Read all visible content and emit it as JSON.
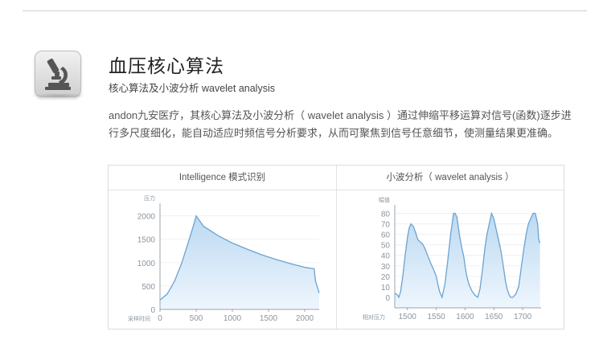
{
  "section": {
    "title": "血压核心算法",
    "subtitle": "核心算法及小波分析 wavelet analysis",
    "description_lines": [
      "andon九安医疗，其核心算法及小波分析（ wavelet analysis ）通过伸缩平移运算对信号(函数)逐步进",
      "行多尺度细化，能自动适应时频信号分析要求，从而可聚焦到信号任意细节，使测量结果更准确。"
    ],
    "icon": "microscope-icon"
  },
  "colors": {
    "line": "#6aa3d1",
    "fill_top": "#bcd9f2",
    "fill_bottom": "#eef6fd",
    "axis": "#9aa4ad",
    "tick_text": "#8a96a0"
  },
  "chart_data": [
    {
      "type": "area",
      "title": "Intelligence 模式识别",
      "ylabel": "压力",
      "xlabel": "采样时间",
      "xlim": [
        0,
        2200
      ],
      "ylim": [
        0,
        2200
      ],
      "x_ticks": [
        0,
        500,
        1000,
        1500,
        2000
      ],
      "y_ticks": [
        0,
        500,
        1000,
        1500,
        2000
      ],
      "grid": true,
      "x": [
        0,
        100,
        200,
        300,
        400,
        470,
        500,
        600,
        800,
        1000,
        1200,
        1400,
        1600,
        1800,
        2000,
        2130,
        2150,
        2200
      ],
      "y": [
        200,
        330,
        600,
        990,
        1480,
        1830,
        2000,
        1780,
        1580,
        1420,
        1290,
        1170,
        1070,
        980,
        900,
        870,
        600,
        350
      ]
    },
    {
      "type": "area",
      "title": "小波分析（ wavelet analysis ）",
      "ylabel": "幅值",
      "xlabel": "相对压力",
      "xlim": [
        1478,
        1732
      ],
      "ylim": [
        -10,
        85
      ],
      "x_ticks": [
        1500,
        1550,
        1600,
        1650,
        1700
      ],
      "y_ticks": [
        0,
        10,
        20,
        30,
        40,
        50,
        60,
        70,
        80
      ],
      "grid": true,
      "x": [
        1478,
        1483,
        1485,
        1488,
        1492,
        1496,
        1500,
        1503,
        1506,
        1510,
        1514,
        1518,
        1522,
        1526,
        1530,
        1535,
        1540,
        1545,
        1550,
        1553,
        1556,
        1560,
        1565,
        1570,
        1575,
        1578,
        1580,
        1583,
        1586,
        1590,
        1594,
        1598,
        1600,
        1603,
        1607,
        1612,
        1617,
        1622,
        1626,
        1630,
        1634,
        1638,
        1642,
        1646,
        1650,
        1654,
        1658,
        1662,
        1665,
        1668,
        1670,
        1673,
        1676,
        1679,
        1683,
        1688,
        1693,
        1698,
        1702,
        1706,
        1710,
        1714,
        1718,
        1722,
        1726,
        1728,
        1730
      ],
      "y": [
        4,
        2,
        0,
        5,
        20,
        40,
        57,
        66,
        70,
        68,
        62,
        55,
        53,
        51,
        47,
        40,
        33,
        27,
        20,
        12,
        5,
        0,
        12,
        35,
        60,
        72,
        80,
        80,
        76,
        60,
        48,
        38,
        30,
        20,
        12,
        6,
        2,
        0,
        8,
        25,
        45,
        60,
        70,
        80,
        75,
        65,
        55,
        45,
        35,
        24,
        16,
        8,
        3,
        0,
        0,
        3,
        10,
        30,
        46,
        60,
        70,
        75,
        80,
        80,
        70,
        55,
        52
      ]
    }
  ]
}
